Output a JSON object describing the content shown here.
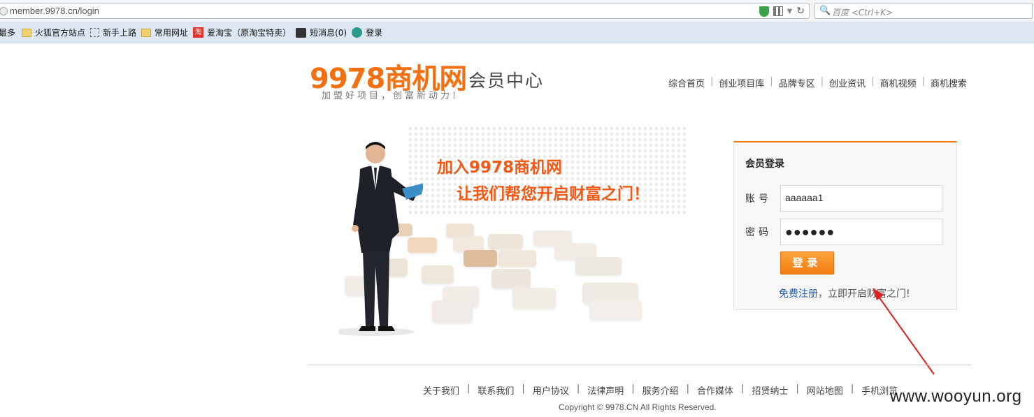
{
  "browser": {
    "url": "member.9978.cn/login",
    "search_placeholder": "百度 <Ctrl+K>",
    "bookmarks": [
      {
        "label": "最多",
        "icon": "none"
      },
      {
        "label": "火狐官方站点",
        "icon": "folder-icon"
      },
      {
        "label": "新手上路",
        "icon": "dashed-folder-icon"
      },
      {
        "label": "常用网址",
        "icon": "folder-icon"
      },
      {
        "label": "爱淘宝（原淘宝特卖）",
        "icon": "taobao-icon",
        "icon_text": "淘"
      },
      {
        "label": "短消息(0)",
        "icon": "message-icon"
      },
      {
        "label": "登录",
        "icon": "login-icon"
      }
    ]
  },
  "header": {
    "logo_text": "9978商机网",
    "slogan": "加盟好项目，创富新动力!",
    "member_center": "会员中心",
    "nav": [
      "综合首页",
      "创业项目库",
      "品牌专区",
      "创业资讯",
      "商机视频",
      "商机搜索"
    ],
    "nav_separator": "|"
  },
  "hero": {
    "line1": "加入9978商机网",
    "line2": "让我们帮您开启财富之门！"
  },
  "login": {
    "title": "会员登录",
    "account_label": "账号",
    "account_value": "aaaaaa1",
    "password_label": "密码",
    "password_value": "●●●●●●",
    "submit_label": "登录",
    "register_link": "免费注册",
    "register_text": "，立即开启财富之门!"
  },
  "footer": {
    "links": [
      "关于我们",
      "联系我们",
      "用户协议",
      "法律声明",
      "服务介绍",
      "合作媒体",
      "招贤纳士",
      "网站地图",
      "手机浏览"
    ],
    "separator": "|",
    "copyright": "Copyright © 9978.CN All Rights Reserved."
  },
  "watermark": "www.wooyun.org",
  "colors": {
    "brand": "#f27012",
    "link": "#1f5aa6",
    "annotation_arrow": "#e02020"
  }
}
